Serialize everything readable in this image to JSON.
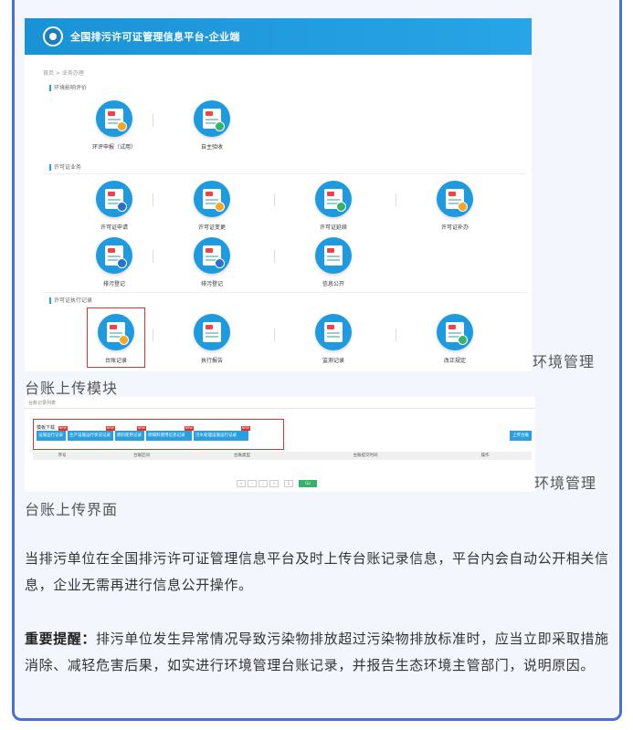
{
  "shot1": {
    "title": "全国排污许可证管理信息平台-企业端",
    "breadcrumb": "首页 > 业务办理",
    "sections": [
      "环境影响评价",
      "许可证业务",
      "许可证执行记录"
    ],
    "tiles": [
      {
        "label": "环评申报（试用）"
      },
      {
        "label": "自主验收"
      },
      {
        "label": "许可证申请"
      },
      {
        "label": "许可证变更"
      },
      {
        "label": "许可证延续"
      },
      {
        "label": "许可证补办"
      },
      {
        "label": "排污登记"
      },
      {
        "label": "排污登记"
      },
      {
        "label": "信息公开"
      },
      {
        "label": "台账记录"
      },
      {
        "label": "执行报告"
      },
      {
        "label": "监测记录"
      },
      {
        "label": "改正规定"
      }
    ]
  },
  "caption1": {
    "line1": "环境管理",
    "line2": "台账上传模块"
  },
  "shot2": {
    "top_label": "台账记录列表",
    "box_title": "模板下载",
    "buttons": [
      "设施运行记录",
      "生产设施运行状况记录",
      "燃料使用记录",
      "原辅料使用信息记录",
      "污水处理设施运行记录"
    ],
    "new_tag": "NEW",
    "upload_label": "上传台账",
    "columns": [
      "序号",
      "台账区间",
      "台账类型",
      "台账提交时间",
      "操作"
    ],
    "pager": [
      "«",
      "‹",
      "›",
      "»",
      "1"
    ],
    "go_label": "Go"
  },
  "caption2": {
    "line1": "环境管理",
    "line2": "台账上传界面"
  },
  "paragraph1": "当排污单位在全国排污许可证管理信息平台及时上传台账记录信息，平台内会自动公开相关信息，企业无需再进行信息公开操作。",
  "paragraph2": {
    "lead": "重要提醒：",
    "body": "排污单位发生异常情况导致污染物排放超过污染物排放标准时，应当立即采取措施消除、减轻危害后果，如实进行环境管理台账记录，并报告生态环境主管部门，说明原因。"
  }
}
